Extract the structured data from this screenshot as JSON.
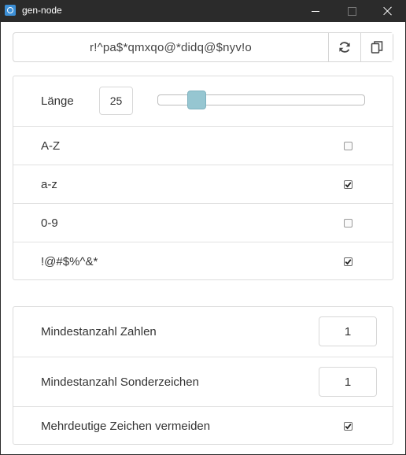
{
  "window": {
    "title": "gen-node"
  },
  "password": {
    "value": "r!^pa$*qmxqo@*didq@$nyv!o",
    "regenerate_icon": "refresh-icon",
    "copy_icon": "copy-icon"
  },
  "options": {
    "length_label": "Länge",
    "length_value": "25",
    "length_slider_fraction": 0.16,
    "charsets": [
      {
        "label": "A-Z",
        "checked": false
      },
      {
        "label": "a-z",
        "checked": true
      },
      {
        "label": "0-9",
        "checked": false
      },
      {
        "label": "!@#$%^&*",
        "checked": true
      }
    ]
  },
  "constraints": {
    "min_numbers_label": "Mindestanzahl Zahlen",
    "min_numbers_value": "1",
    "min_symbols_label": "Mindestanzahl Sonderzeichen",
    "min_symbols_value": "1",
    "avoid_ambiguous_label": "Mehrdeutige Zeichen vermeiden",
    "avoid_ambiguous_checked": true
  },
  "colors": {
    "slider_thumb": "#96c6d1",
    "titlebar": "#2b2b2b"
  }
}
